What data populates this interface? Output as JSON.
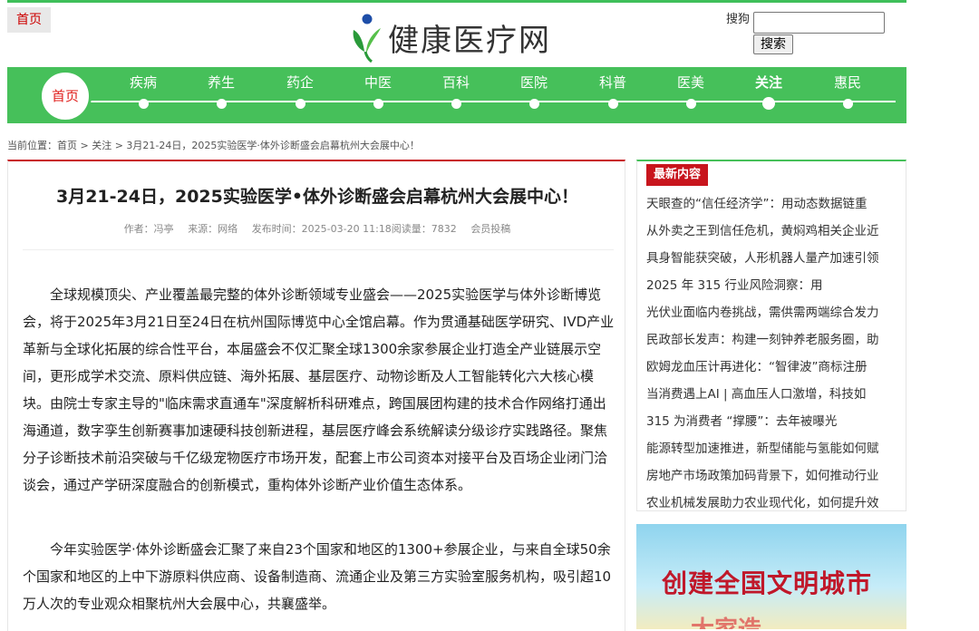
{
  "header": {
    "home_label": "首页",
    "logo_text": "健康医疗网",
    "sogou_alt": "搜狗",
    "search_button": "搜索",
    "search_placeholder": ""
  },
  "nav": {
    "home": "首页",
    "items": [
      "疾病",
      "养生",
      "药企",
      "中医",
      "百科",
      "医院",
      "科普",
      "医美",
      "关注",
      "惠民"
    ],
    "active": "关注"
  },
  "breadcrumb": "当前位置：首页 > 关注 > 3月21-24日，2025实验医学·体外诊断盛会启幕杭州大会展中心！",
  "article": {
    "title": "3月21-24日，2025实验医学•体外诊断盛会启幕杭州大会展中心！",
    "author": "作者：冯亭",
    "source": "来源：网络",
    "time_views": "发布时间：2025-03-20 11:18阅读量：7832",
    "submit": "会员投稿",
    "para1": "全球规模顶尖、产业覆盖最完整的体外诊断领域专业盛会——2025实验医学与体外诊断博览会，将于2025年3月21日至24日在杭州国际博览中心全馆启幕。作为贯通基础医学研究、IVD产业革新与全球化拓展的综合性平台，本届盛会不仅汇聚全球1300余家参展企业打造全产业链展示空间，更形成学术交流、原料供应链、海外拓展、基层医疗、动物诊断及人工智能转化六大核心模块。由院士专家主导的\"临床需求直通车\"深度解析科研难点，跨国展团构建的技术合作网络打通出海通道，数字孪生创新赛事加速硬科技创新进程，基层医疗峰会系统解读分级诊疗实践路径。聚焦分子诊断技术前沿突破与千亿级宠物医疗市场开发，配套上市公司资本对接平台及百场企业闭门洽谈会，通过产学研深度融合的创新模式，重构体外诊断产业价值生态体系。",
    "para2": "今年实验医学·体外诊断盛会汇聚了来自23个国家和地区的1300+参展企业，与来自全球50余个国家和地区的上中下游原料供应商、设备制造商、流通企业及第三方实验室服务机构，吸引超10万人次的专业观众相聚杭州大会展中心，共襄盛举。"
  },
  "sidebar": {
    "heading": "最新内容",
    "items": [
      "天眼查的“信任经济学”：用动态数据链重",
      "从外卖之王到信任危机，黄焖鸡相关企业近",
      "具身智能获突破，人形机器人量产加速引领",
      "2025 年 315 行业风险洞察：用",
      "光伏业面临内卷挑战，需供需两端综合发力",
      "民政部长发声：构建一刻钟养老服务圈，助",
      "欧姆龙血压计再进化：“智律波”商标注册",
      "当消费遇上AI | 高血压人口激增，科技如",
      "315 为消费者 “撑腰”：去年被曝光",
      "能源转型加速推进，新型储能与氢能如何赋",
      "房地产市场政策加码背景下，如何推动行业",
      "农业机械发展助力农业现代化，如何提升效"
    ]
  },
  "banner": {
    "line1": "创建全国文明城市",
    "line2": "大家造"
  },
  "colors": {
    "accent_green": "#46c05a",
    "accent_red": "#c8151d"
  }
}
